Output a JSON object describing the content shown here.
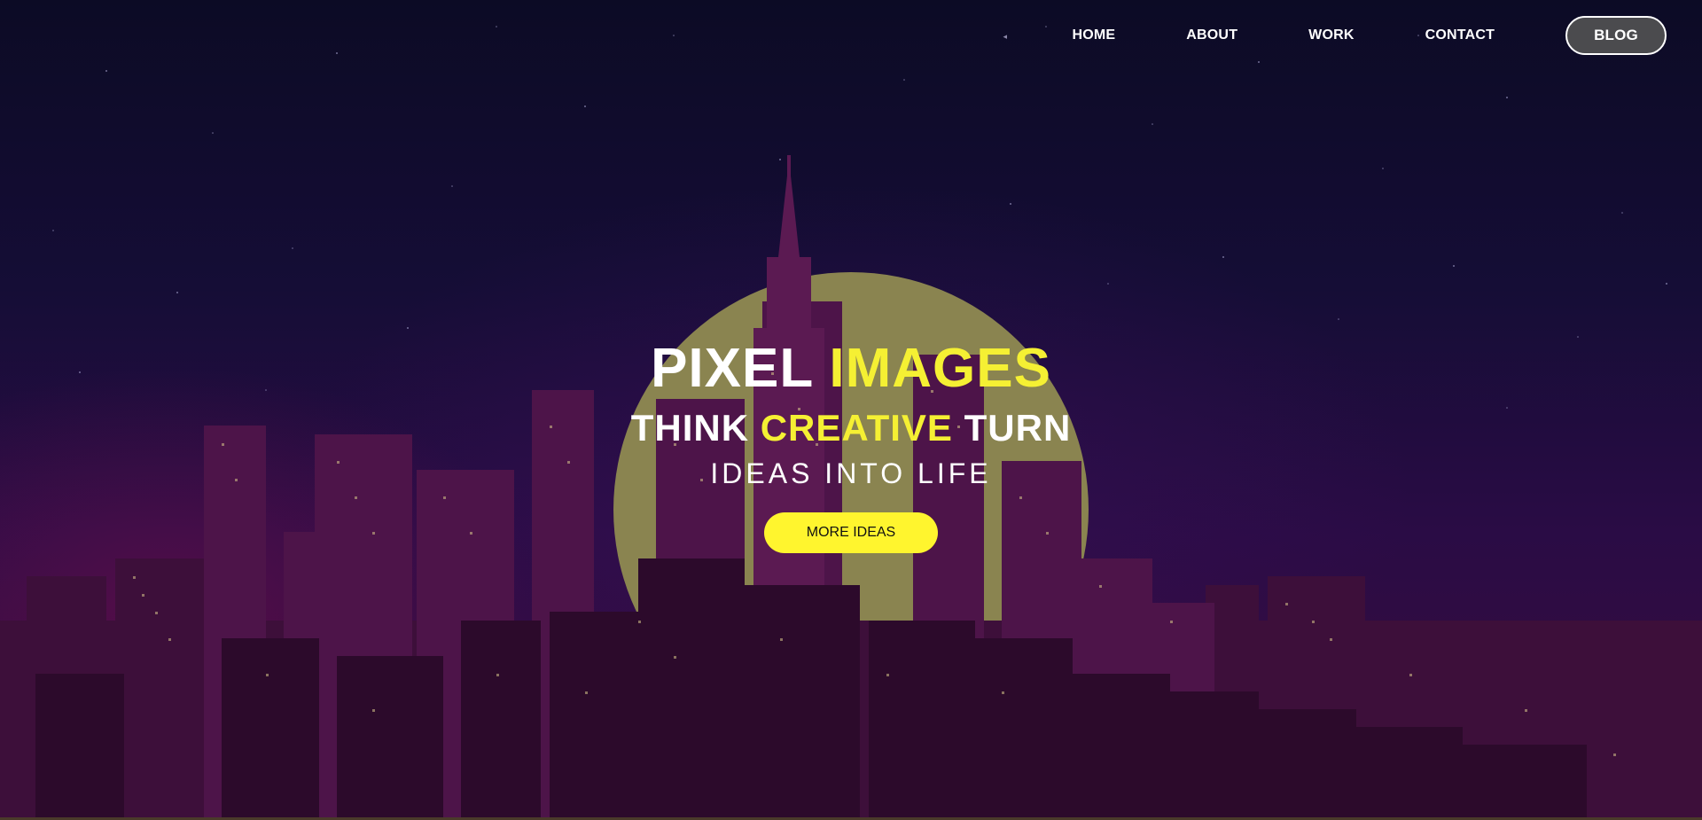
{
  "nav": {
    "items": [
      {
        "label": "HOME"
      },
      {
        "label": "ABOUT"
      },
      {
        "label": "WORK"
      },
      {
        "label": "CONTACT"
      }
    ],
    "blog_label": "BLOG"
  },
  "hero": {
    "title_part1": "PIXEL",
    "title_part2": "IMAGES",
    "sub_part1": "THINK",
    "sub_part2": "CREATIVE",
    "sub_part3": "TURN",
    "tagline": "IDEAS INTO LIFE",
    "cta_label": "MORE IDEAS"
  },
  "colors": {
    "accent": "#f5f033",
    "cta_bg": "#fff52e",
    "moon": "#8a8450",
    "sky_top": "#0c0b25",
    "sky_bottom": "#3a0b3d"
  }
}
